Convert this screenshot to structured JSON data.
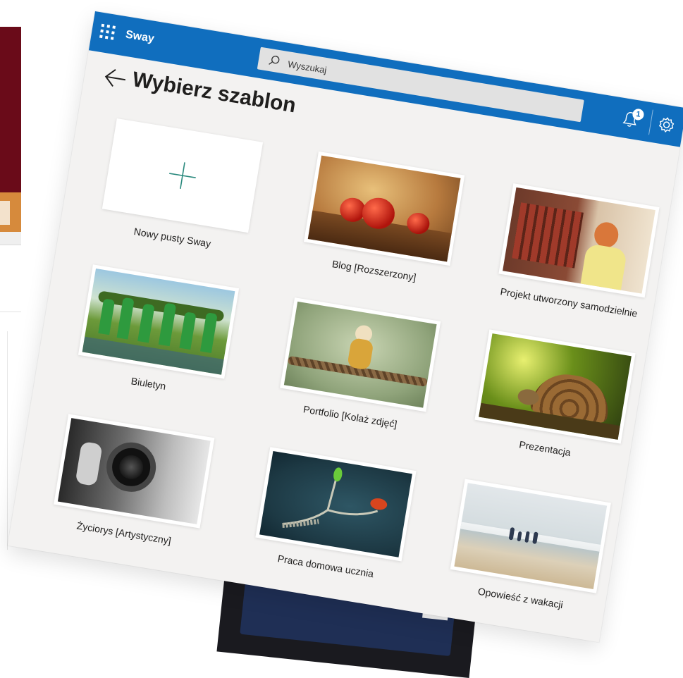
{
  "app": {
    "name": "Sway"
  },
  "search": {
    "placeholder": "Wyszukaj"
  },
  "notifications": {
    "count": "1"
  },
  "page": {
    "title": "Wybierz szablon"
  },
  "templates": [
    {
      "label": "Nowy pusty Sway",
      "thumb": "plus-icon"
    },
    {
      "label": "Blog [Rozszerzony]",
      "thumb": "tomatoes-photo"
    },
    {
      "label": "Projekt utworzony samodzielnie",
      "thumb": "girl-painting-fence-photo"
    },
    {
      "label": "Biuletyn",
      "thumb": "volunteers-group-photo"
    },
    {
      "label": "Portfolio [Kolaż zdjęć]",
      "thumb": "monkey-on-rope-photo"
    },
    {
      "label": "Prezentacja",
      "thumb": "tortoise-photo"
    },
    {
      "label": "Życiorys [Artystyczny]",
      "thumb": "photographer-camera-photo"
    },
    {
      "label": "Praca domowa ucznia",
      "thumb": "caterpillar-butterfly-photo"
    },
    {
      "label": "Opowieść z wakacji",
      "thumb": "family-beach-photo"
    }
  ],
  "colors": {
    "topbar": "#106ebe",
    "canvas": "#f3f2f1",
    "accent_plus": "#2b8a7e"
  }
}
